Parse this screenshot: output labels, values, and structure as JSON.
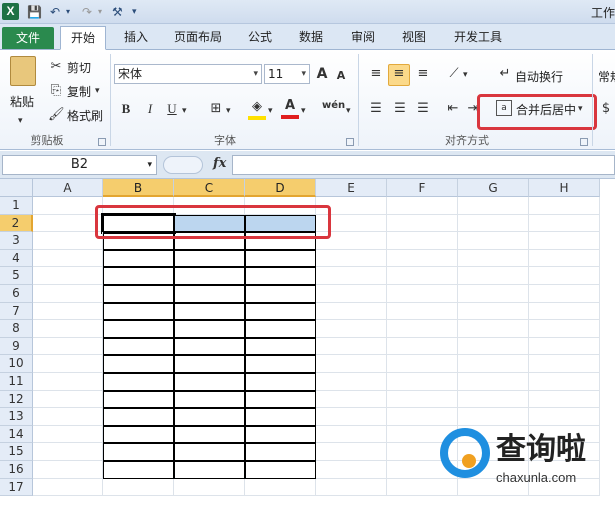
{
  "window": {
    "title": "工作"
  },
  "quick_access": {
    "logo": "X",
    "save": "💾",
    "undo": "↶",
    "redo": "↷",
    "extra": "⚒"
  },
  "tabs": [
    {
      "label": "文件"
    },
    {
      "label": "开始"
    },
    {
      "label": "插入"
    },
    {
      "label": "页面布局"
    },
    {
      "label": "公式"
    },
    {
      "label": "数据"
    },
    {
      "label": "审阅"
    },
    {
      "label": "视图"
    },
    {
      "label": "开发工具"
    }
  ],
  "clipboard": {
    "paste": "粘贴",
    "cut": "剪切",
    "copy": "复制",
    "format_painter": "格式刷",
    "group": "剪贴板"
  },
  "font": {
    "name": "宋体",
    "size": "11",
    "group": "字体",
    "grow": "A",
    "shrink": "A",
    "bold": "B",
    "italic": "I",
    "underline": "U",
    "wen": "wén"
  },
  "alignment": {
    "wrap_text": "自动换行",
    "merge_center": "合并后居中",
    "group": "对齐方式"
  },
  "number": {
    "format": "常规"
  },
  "formula_bar": {
    "name_box": "B2",
    "fx": "fx"
  },
  "sheet": {
    "columns": [
      "A",
      "B",
      "C",
      "D",
      "E",
      "F",
      "G",
      "H"
    ],
    "rows": [
      "1",
      "2",
      "3",
      "4",
      "5",
      "6",
      "7",
      "8",
      "9",
      "10",
      "11",
      "12",
      "13",
      "14",
      "15",
      "16",
      "17"
    ],
    "selected_cell": "B2",
    "selected_range": "B2:D2",
    "highlight_color": "#bcd6ef",
    "accent_color": "#d9363e"
  },
  "watermark": {
    "brand": "查询啦",
    "url": "chaxunla.com"
  }
}
